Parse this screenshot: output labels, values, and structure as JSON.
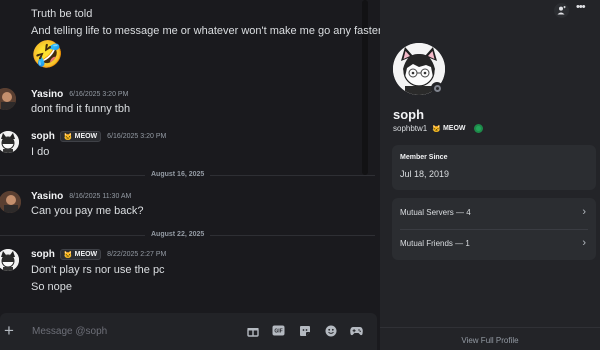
{
  "chat": {
    "top_lines": [
      "Truth be told",
      "And telling life to message me or whatever won't make me go any faster"
    ],
    "emoji": "🤣",
    "messages": [
      {
        "author": "Yasino",
        "timestamp": "6/16/2025 3:20 PM",
        "lines": [
          "dont find it funny tbh"
        ]
      },
      {
        "author": "soph",
        "tag": "MEOW",
        "timestamp": "6/16/2025 3:20 PM",
        "lines": [
          "I do"
        ]
      },
      {
        "author": "Yasino",
        "timestamp": "8/16/2025 11:30 AM",
        "lines": [
          "Can you pay me back?"
        ]
      },
      {
        "author": "soph",
        "tag": "MEOW",
        "timestamp": "8/22/2025 2:27 PM",
        "lines": [
          "Don't play rs nor use the pc",
          "So nope"
        ]
      }
    ],
    "dividers": [
      "August 16, 2025",
      "August 22, 2025"
    ]
  },
  "composer": {
    "placeholder": "Message @soph",
    "plus_icon": "+",
    "icons": [
      "gift-icon",
      "gif-icon",
      "sticker-icon",
      "emoji-icon",
      "game-controller-icon"
    ]
  },
  "profile": {
    "display_name": "soph",
    "username": "sophbtw1",
    "tag": "MEOW",
    "status": "offline",
    "member_since_label": "Member Since",
    "member_since": "Jul 18, 2019",
    "mutual_servers": "Mutual Servers — 4",
    "mutual_friends": "Mutual Friends — 1",
    "view_full_profile": "View Full Profile",
    "more_icon": "•••"
  },
  "colors": {
    "background": "#1a1a1e",
    "panel": "#232428",
    "card": "#2b2d31",
    "badge": "#23a55a"
  }
}
